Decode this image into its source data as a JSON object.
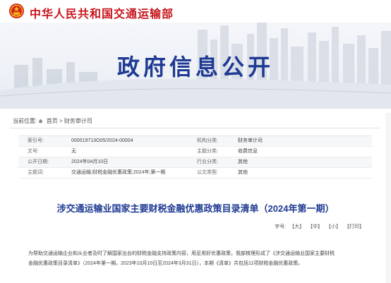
{
  "header": {
    "site_title": "中华人民共和国交通运输部",
    "emblem_icon": "national-emblem-icon",
    "accent_color": "#c8161d"
  },
  "banner": {
    "title": "政府信息公开",
    "title_color": "#1f3a93"
  },
  "breadcrumb": {
    "prefix": "当前位置:",
    "home": "首页",
    "separator": ">",
    "current": "财务审计司",
    "home_icon": "home-icon"
  },
  "meta": {
    "rows": [
      {
        "k1": "索引号:",
        "v1": "000019713O05/2024-00004",
        "k2": "机构分类:",
        "v2": "财务审计司"
      },
      {
        "k1": "文号:",
        "v1": "无",
        "k2": "主题分类:",
        "v2": "收费信息"
      },
      {
        "k1": "公开日期:",
        "v1": "2024年04月10日",
        "k2": "行业分类:",
        "v2": "其他"
      },
      {
        "k1": "主题词:",
        "v1": "交通运输;财税金融优惠政策;2024年;第一期",
        "k2": "公文类型:",
        "v2": "其他"
      }
    ]
  },
  "article": {
    "title": "涉交通运输业国家主要财税金融优惠政策目录清单（2024年第一期）",
    "fontsize_label": "字号:",
    "font_large": "【大】",
    "font_medium": "【中】",
    "font_small": "【小】",
    "print": "【打印】",
    "para1": "为帮助交通运输企业和从业者及时了解国家出台的财税金融支持政策内容，用足用好优惠政策，我部梳理形成了《涉交通运输业国家主要财税",
    "para2": "金融优惠政策目录清单》（2024年第一期，2023年10月10日至2024年3月31日），本期《清单》共包括11项财税金融优惠政策。"
  }
}
